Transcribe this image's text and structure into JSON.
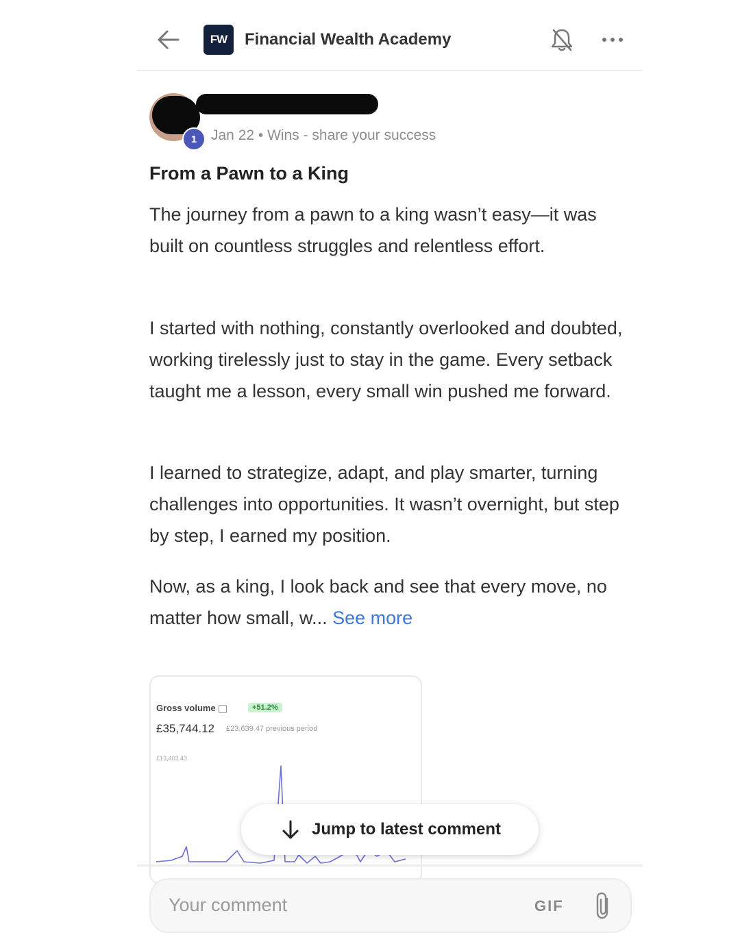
{
  "header": {
    "logo_text": "FW",
    "group_title": "Financial Wealth Academy",
    "icons": [
      "arrow-left-icon",
      "bell-off-icon",
      "more-horizontal-icon"
    ]
  },
  "post": {
    "level": "1",
    "meta": "Jan 22 • Wins - share your success",
    "title": "From a Pawn to a King",
    "paragraphs": [
      "The journey from a pawn to a king wasn’t easy—it was built on countless struggles and relentless effort.",
      "I started with nothing, constantly overlooked and doubted, working tirelessly just to stay in the game. Every setback taught me a lesson, every small win pushed me forward.",
      "I learned to strategize, adapt, and play smarter, turning challenges into opportunities. It wasn’t overnight, but step by step, I earned my position."
    ],
    "last_paragraph": "Now, as a king, I look back and see that every move, no matter how small, w...",
    "see_more": "See more"
  },
  "attachment": {
    "label": "Gross volume",
    "badge": "+51.2%",
    "amount": "£35,744.12",
    "previous": "£23,639.47 previous period",
    "axis_max": "£13,403.43"
  },
  "jump_label": "Jump to latest comment",
  "comment_bar": {
    "placeholder": "Your comment",
    "gif_label": "GIF"
  },
  "colors": {
    "accent_blue": "#3b78d8",
    "logo_bg": "#14213d",
    "level_badge": "#4a56b8",
    "chart_line": "#6b6fd6"
  }
}
